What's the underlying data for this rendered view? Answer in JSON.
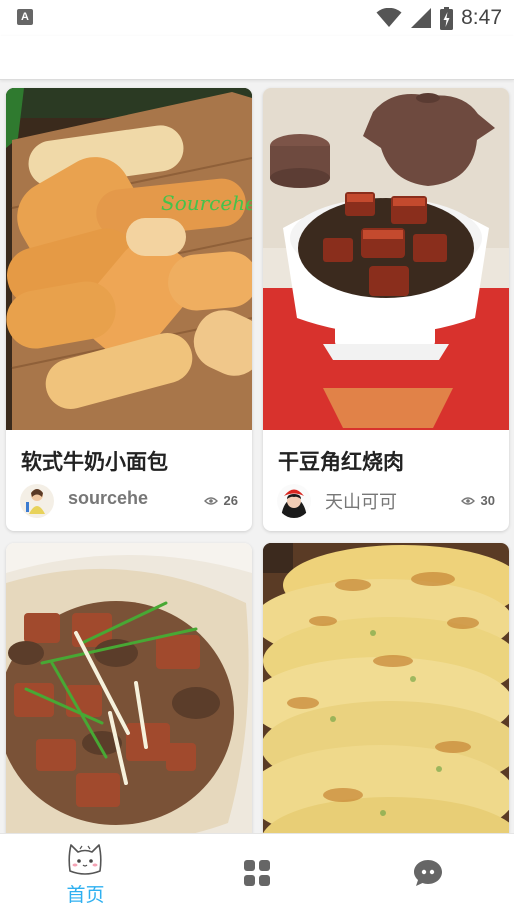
{
  "status_bar": {
    "app_icon_glyph": "A",
    "time": "8:47"
  },
  "feed": {
    "cards": [
      {
        "title": "软式牛奶小面包",
        "author": "sourcehe",
        "views": "26",
        "watermark": "Sourcehe"
      },
      {
        "title": "干豆角红烧肉",
        "author": "天山可可",
        "views": "30"
      },
      {
        "title": "",
        "author": "",
        "views": ""
      },
      {
        "title": "",
        "author": "",
        "views": ""
      }
    ]
  },
  "tab_bar": {
    "tabs": [
      {
        "label": "首页",
        "icon": "cat-face-icon",
        "active": true
      },
      {
        "label": "",
        "icon": "grid-icon",
        "active": false
      },
      {
        "label": "",
        "icon": "chat-bubble-icon",
        "active": false
      }
    ],
    "active_color": "#2fb0f0",
    "inactive_color": "#666666"
  }
}
